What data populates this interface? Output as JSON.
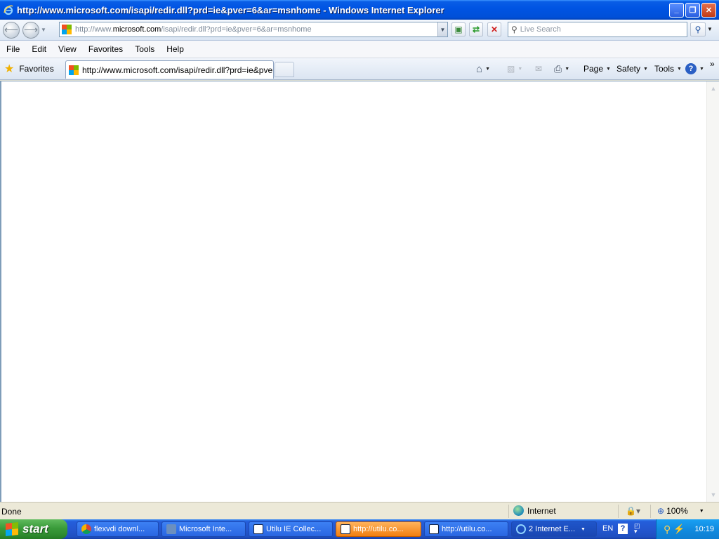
{
  "window": {
    "title": "http://www.microsoft.com/isapi/redir.dll?prd=ie&pver=6&ar=msnhome - Windows Internet Explorer",
    "minimize": "_",
    "maximize": "❐",
    "close": "✕"
  },
  "navbar": {
    "back_glyph": "⟵",
    "forward_glyph": "⟶",
    "url_prefix": "http://www.",
    "url_domain": "microsoft.com",
    "url_suffix": "/isapi/redir.dll?prd=ie&pver=6&ar=msnhome",
    "search_placeholder": "Live Search"
  },
  "menu": {
    "items": [
      "File",
      "Edit",
      "View",
      "Favorites",
      "Tools",
      "Help"
    ]
  },
  "tabbar": {
    "favorites_label": "Favorites",
    "tab_title": "http://www.microsoft.com/isapi/redir.dll?prd=ie&pver...",
    "commands": [
      "Page",
      "Safety",
      "Tools"
    ]
  },
  "status": {
    "text": "Done",
    "zone": "Internet",
    "zoom": "100%"
  },
  "taskbar": {
    "start_label": "start",
    "tasks": [
      {
        "label": "flexvdi downl..."
      },
      {
        "label": "Microsoft Inte..."
      },
      {
        "label": "Utilu IE Collec..."
      },
      {
        "label": "http://utilu.co..."
      },
      {
        "label": "http://utilu.co..."
      },
      {
        "label": "2 Internet E..."
      }
    ],
    "lang": "EN",
    "clock": "10:19"
  },
  "colors": {
    "title_bar": "#0054e3",
    "active_task": "#f27e10",
    "start_button": "#3a9b3a"
  }
}
